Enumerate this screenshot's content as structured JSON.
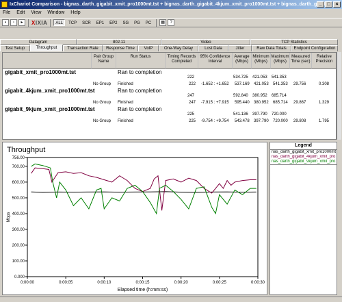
{
  "window": {
    "title": "IxChariot Comparison - bignas_darth_gigabit_xmit_pro1000mt.tst + bignas_darth_gigabit_4kjum_xmit_pro1000mt.tst + bignas_darth_gigabit...",
    "min_glyph": "_",
    "max_glyph": "□",
    "close_glyph": "×"
  },
  "menu": [
    "File",
    "Edit",
    "View",
    "Window",
    "Help"
  ],
  "toolbar": {
    "logo_prefix": "X",
    "logo_text": "IXIA",
    "filters": [
      "ALL",
      "TCP",
      "SCR",
      "EP1",
      "EP2",
      "SG",
      "PG",
      "PC"
    ]
  },
  "groups": [
    "Datagram",
    "802.11",
    "Video",
    "TCP Statistics"
  ],
  "tabs": [
    "Test Setup",
    "Throughput",
    "Transaction Rate",
    "Response Time",
    "VoIP",
    "One-Way Delay",
    "Lost Data",
    "Jitter",
    "Raw Data Totals",
    "Endpoint Configuration"
  ],
  "active_tab": "Throughput",
  "columns": [
    "",
    "Pair Group Name",
    "Run Status",
    "Timing Records Completed",
    "95% Confidence Interval",
    "Average (Mbps)",
    "Minimum (Mbps)",
    "Maximum (Mbps)",
    "Measured Time (sec)",
    "Relative Precision"
  ],
  "rows": [
    {
      "name": "gigabit_xmit_pro1000mt.tst",
      "status": "Ran to completion",
      "records": "222",
      "ci": "",
      "avg": "534.725",
      "min": "421.053",
      "max": "541.353",
      "time": "",
      "prec": "",
      "sub": {
        "group": "No Group",
        "status": "Finished",
        "records": "222",
        "ci": "-1.652 : +1.652",
        "avg": "537.169",
        "min": "421.053",
        "max": "541.353",
        "time": "29.756",
        "prec": "0.308"
      }
    },
    {
      "name": "gigabit_4kjum_xmit_pro1000mt.tst",
      "status": "Ran to completion",
      "records": "247",
      "ci": "",
      "avg": "592.840",
      "min": "380.952",
      "max": "685.714",
      "time": "",
      "prec": "",
      "sub": {
        "group": "No Group",
        "status": "Finished",
        "records": "247",
        "ci": "-7.915 : +7.915",
        "avg": "595.440",
        "min": "380.952",
        "max": "685.714",
        "time": "29.867",
        "prec": "1.329"
      }
    },
    {
      "name": "gigabit_9kjum_xmit_pro1000mt.tst",
      "status": "Ran to completion",
      "records": "225",
      "ci": "",
      "avg": "541.136",
      "min": "397.790",
      "max": "720.000",
      "time": "",
      "prec": "",
      "sub": {
        "group": "No Group",
        "status": "Finished",
        "records": "225",
        "ci": "-9.754 : +9.754",
        "avg": "543.478",
        "min": "397.790",
        "max": "720.000",
        "time": "29.808",
        "prec": "1.795"
      }
    }
  ],
  "legend": {
    "title": "Legend",
    "items": [
      {
        "label": "nas_darth_gigabit_xmit_pro1000mt",
        "color": "#000000"
      },
      {
        "label": "nas_darth_gigabit_4kjum_xmit_pro",
        "color": "#800040"
      },
      {
        "label": "nas_darth_gigabit_9kjum_xmit_pro",
        "color": "#008000"
      }
    ]
  },
  "chart_data": {
    "type": "line",
    "title": "Throughput",
    "xlabel": "Elapsed time (h:mm:ss)",
    "ylabel": "Mbps",
    "xlim": [
      0,
      30
    ],
    "ylim": [
      0,
      756
    ],
    "yticks": [
      "756.00",
      "700.00",
      "600.00",
      "500.00",
      "400.00",
      "300.00",
      "200.00",
      "100.00",
      "0.000"
    ],
    "xticks": [
      "0:00:00",
      "0:00:05",
      "0:00:10",
      "0:00:15",
      "0:00:20",
      "0:00:25",
      "0:00:30"
    ],
    "grid": false,
    "series": [
      {
        "name": "nas_darth_gigabit_xmit_pro1000mt",
        "color": "#000000",
        "x": [
          0.5,
          2,
          4,
          6,
          8,
          10,
          12,
          14,
          16,
          18,
          20,
          22,
          24,
          26,
          28,
          29.8
        ],
        "y": [
          538,
          535,
          537,
          536,
          537,
          538,
          536,
          537,
          538,
          539,
          536,
          535,
          537,
          538,
          536,
          537
        ]
      },
      {
        "name": "nas_darth_gigabit_4kjum_xmit_pro",
        "color": "#800040",
        "x": [
          0.5,
          1,
          2,
          2.8,
          3.2,
          4,
          5,
          6,
          7,
          8,
          9,
          10,
          11,
          12,
          13,
          14,
          15,
          16,
          16.5,
          17,
          17.5,
          18,
          19,
          20,
          21,
          22,
          23,
          24,
          25,
          25.5,
          26,
          26.5,
          27,
          28,
          29,
          29.8
        ],
        "y": [
          655,
          690,
          685,
          680,
          600,
          660,
          665,
          655,
          660,
          640,
          630,
          615,
          600,
          640,
          610,
          560,
          540,
          560,
          620,
          640,
          420,
          610,
          620,
          600,
          625,
          610,
          560,
          530,
          590,
          560,
          610,
          580,
          600,
          610,
          615,
          615
        ]
      },
      {
        "name": "nas_darth_gigabit_9kjum_xmit_pro",
        "color": "#008000",
        "x": [
          0.5,
          1,
          2,
          3,
          3.3,
          3.8,
          4.2,
          5,
          6,
          7,
          8,
          9,
          9.6,
          10,
          11,
          12,
          13,
          14,
          15,
          16,
          16.8,
          17.2,
          18,
          19,
          20,
          21,
          22,
          23,
          24,
          24.5,
          25,
          26,
          27,
          28,
          29,
          29.8
        ],
        "y": [
          700,
          715,
          705,
          690,
          600,
          500,
          600,
          550,
          450,
          500,
          430,
          550,
          560,
          430,
          500,
          480,
          560,
          580,
          540,
          470,
          400,
          560,
          580,
          540,
          490,
          430,
          560,
          570,
          440,
          400,
          520,
          460,
          550,
          520,
          560,
          560
        ]
      }
    ]
  }
}
